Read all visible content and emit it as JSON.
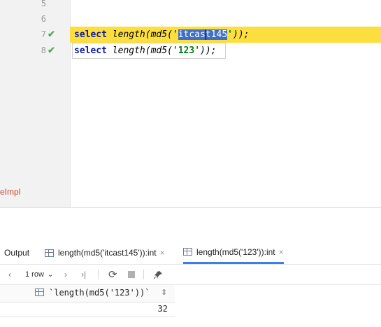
{
  "editor": {
    "line_numbers": [
      "5",
      "6",
      "7",
      "8"
    ],
    "line7": {
      "kw": "select",
      "fn_open": " length(md5(",
      "q1": "'",
      "sel_a": "itcas",
      "sel_b": "t145",
      "q2": "'",
      "close": "));"
    },
    "line8": {
      "kw": "select",
      "fn_open": " length(md5(",
      "str": "'123'",
      "close": "));"
    },
    "left_label": "eImpl"
  },
  "results": {
    "output_tab": "Output",
    "tabs": [
      {
        "label": "length(md5('itcast145')):int",
        "close": "×"
      },
      {
        "label": "length(md5('123')):int",
        "close": "×"
      }
    ],
    "toolbar": {
      "rows_label": "1 row",
      "icons": [
        "arrow-left-icon",
        "rows-dropdown",
        "arrow-right-icon",
        "last-page-icon",
        "refresh-icon",
        "stop-icon",
        "pin-icon"
      ]
    },
    "column_header": "`length(md5('123'))`",
    "sort_icon": "⇕",
    "row_value": "32"
  },
  "colors": {
    "current_line": "#fcdf3e",
    "selection": "#3e6fc9",
    "keyword": "#0c1a9a",
    "string": "#067d17",
    "check": "#4caf50",
    "active_tab": "#3d7ee6"
  }
}
